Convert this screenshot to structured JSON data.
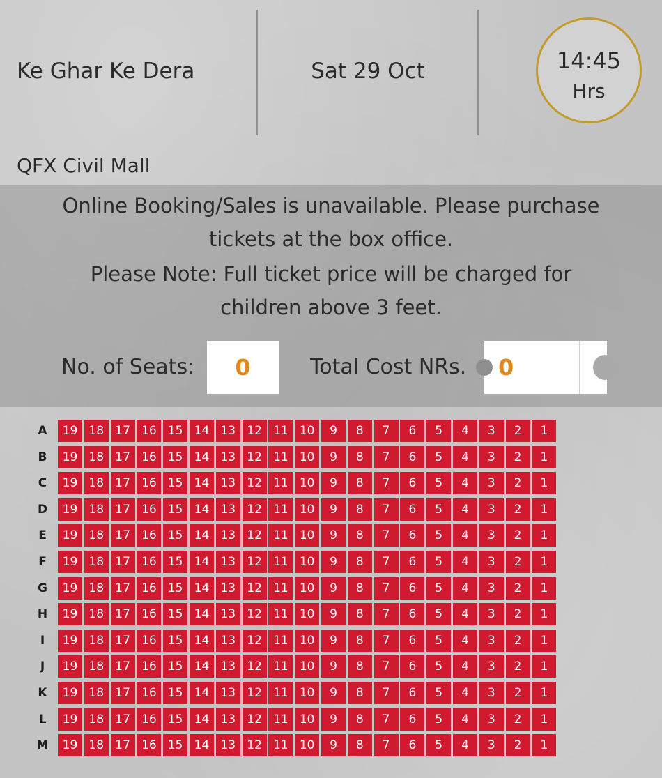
{
  "header": {
    "movie_title": "Ke Ghar Ke Dera",
    "show_date": "Sat 29 Oct",
    "show_time": "14:45",
    "time_unit": "Hrs"
  },
  "cinema_name": "QFX Civil Mall",
  "notice": {
    "lines": [
      "Online Booking/Sales is unavailable. Please purchase",
      "tickets at the box office.",
      "Please Note: Full ticket price will be charged for",
      "children above 3 feet."
    ]
  },
  "booking": {
    "seats_label": "No. of Seats:",
    "seats_value": "0",
    "cost_label": "Total Cost NRs.",
    "cost_value": "0"
  },
  "seat_map": {
    "rows": [
      "A",
      "B",
      "C",
      "D",
      "E",
      "F",
      "G",
      "H",
      "I",
      "J",
      "K",
      "L",
      "M"
    ],
    "seat_numbers": [
      "19",
      "18",
      "17",
      "16",
      "15",
      "14",
      "13",
      "12",
      "11",
      "10",
      "9",
      "8",
      "7",
      "6",
      "5",
      "4",
      "3",
      "2",
      "1"
    ],
    "seat_status": "unavailable"
  },
  "colors": {
    "seat_unavailable": "#d01a2f",
    "accent_orange": "#e08a1e",
    "time_ring_gold": "#c49a2c"
  }
}
